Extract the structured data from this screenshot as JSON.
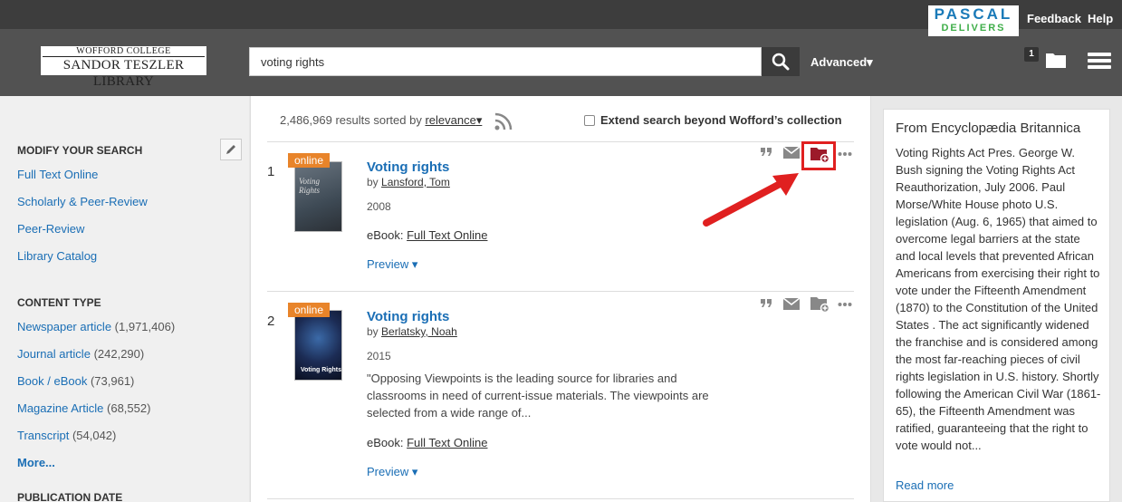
{
  "topbar": {
    "pascal_line1": "PASCAL",
    "pascal_line2": "DELIVERS",
    "feedback": "Feedback",
    "help": "Help"
  },
  "header": {
    "logo_line1": "WOFFORD COLLEGE",
    "logo_line2": "SANDOR TESZLER LIBRARY",
    "search_value": "voting rights",
    "advanced": "Advanced▾",
    "folder_count": "1"
  },
  "sidebar": {
    "modify_heading": "MODIFY YOUR SEARCH",
    "modify_links": [
      "Full Text Online",
      "Scholarly & Peer-Review",
      "Peer-Review",
      "Library Catalog"
    ],
    "content_heading": "CONTENT TYPE",
    "content_types": [
      {
        "label": "Newspaper article",
        "count": "(1,971,406)"
      },
      {
        "label": "Journal article",
        "count": "(242,290)"
      },
      {
        "label": "Book / eBook",
        "count": "(73,961)"
      },
      {
        "label": "Magazine Article",
        "count": "(68,552)"
      },
      {
        "label": "Transcript",
        "count": "(54,042)"
      }
    ],
    "more": "More...",
    "pubdate_heading": "PUBLICATION DATE"
  },
  "results_header": {
    "count_text": "2,486,969 results sorted by",
    "sort": "relevance",
    "extend": "Extend search beyond Wofford’s collection"
  },
  "results": [
    {
      "num": "1",
      "badge": "online",
      "cover_text": "Voting Rights",
      "title": "Voting rights",
      "by": "by",
      "author": "Lansford, Tom",
      "year": "2008",
      "format": "eBook:",
      "link": "Full Text Online",
      "preview": "Preview ▾"
    },
    {
      "num": "2",
      "badge": "online",
      "cover_text": "Voting Rights",
      "title": "Voting rights",
      "by": "by",
      "author": "Berlatsky, Noah",
      "year": "2015",
      "description": "\"Opposing Viewpoints is the leading source for libraries and classrooms in need of current-issue materials. The viewpoints are selected from a wide range of...",
      "format": "eBook:",
      "link": "Full Text Online",
      "preview": "Preview ▾"
    }
  ],
  "britannica": {
    "title": "From Encyclopædia Britannica",
    "text": "Voting Rights Act Pres. George W. Bush signing the Voting Rights Act Reauthorization, July 2006. Paul Morse/White House photo U.S. legislation (Aug. 6, 1965) that aimed to overcome legal barriers at the state and local levels that prevented African Americans from exercising their right to vote under the Fifteenth Amendment (1870) to the Constitution of the United States . The act significantly widened the franchise and is considered among the most far-reaching pieces of civil rights legislation in U.S. history. Shortly following the American Civil War (1861-65), the Fifteenth Amendment was ratified, guaranteeing that the right to vote would not...",
    "read_more": "Read more"
  },
  "colors": {
    "link": "#1a6eb5",
    "badge": "#e8842a",
    "highlight": "#e02020",
    "header_bg": "#525252"
  }
}
